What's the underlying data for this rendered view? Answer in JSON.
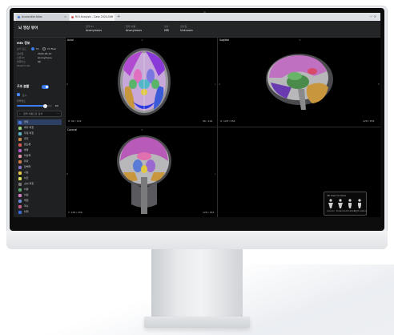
{
  "browser": {
    "tabs": [
      {
        "label": "Accessible Atlas"
      },
      {
        "label": "ROI Analysis - Case 2024-019"
      }
    ],
    "new_tab": "+",
    "window_controls": "—  ×"
  },
  "header": {
    "title": "뇌 영상 뷰어",
    "fields": [
      {
        "label": "환자 ID",
        "value": "Anonymous"
      },
      {
        "label": "환자 이름",
        "value": "Anonymous"
      },
      {
        "label": "검사",
        "value": "MRI"
      },
      {
        "label": "검사일",
        "value": "Unknown"
      }
    ]
  },
  "sidebar": {
    "mri_section": "MRI 정보",
    "view_label": "보기 모드",
    "view_options": [
      "T1",
      "T2 Flair"
    ],
    "rows": [
      {
        "key": "검사일",
        "value": "2024-05-12"
      },
      {
        "key": "스캔 ID",
        "value": "Anonymous"
      },
      {
        "key": "슬라이스",
        "value": "96"
      },
      {
        "key": "Stretch Val.",
        "value": ""
      }
    ],
    "roi_section": "구조 분할",
    "show_label": "표시",
    "opacity_label": "불투명도",
    "opacity_value": "80",
    "opacity_pct": 0.8,
    "search_placeholder": "영역 이름으로 검색",
    "regions": [
      {
        "name": "전두",
        "color": "#4a78d8"
      },
      {
        "name": "측두 피질",
        "color": "#9ad07a"
      },
      {
        "name": "두정 피질",
        "color": "#5fb4c8"
      },
      {
        "name": "후두",
        "color": "#c48a46"
      },
      {
        "name": "편도체",
        "color": "#d45a5a"
      },
      {
        "name": "해마",
        "color": "#b85ac8"
      },
      {
        "name": "미상핵",
        "color": "#e08fa0"
      },
      {
        "name": "피각",
        "color": "#d07a48"
      },
      {
        "name": "창백핵",
        "color": "#8a74c8"
      },
      {
        "name": "시상",
        "color": "#e4c84a"
      },
      {
        "name": "뇌간",
        "color": "#e0e060"
      },
      {
        "name": "소뇌 피질",
        "color": "#7a7a7a"
      },
      {
        "name": "뇌량",
        "color": "#5aa86a"
      },
      {
        "name": "뇌실",
        "color": "#d07ac0"
      },
      {
        "name": "백질",
        "color": "#6a8ad8"
      },
      {
        "name": "척수",
        "color": "#c85a8a"
      },
      {
        "name": "뇌척",
        "color": "#3a6ae0"
      }
    ]
  },
  "viewports": [
    {
      "label": "Axial",
      "info_left": "Z: 96 / 192",
      "info_right": "96 / 192",
      "markers": {
        "left": "R",
        "right": "L",
        "top": "A",
        "bottom": "P"
      }
    },
    {
      "label": "Sagittal",
      "info_left": "X: 128 / 256",
      "info_right": "128 / 256",
      "markers": {
        "left": "A",
        "right": "P",
        "top": "S",
        "bottom": "I"
      }
    },
    {
      "label": "Coronal",
      "info_left": "Y: 128 / 256",
      "info_right": "128 / 256",
      "markers": {
        "left": "R",
        "right": "L",
        "top": "S",
        "bottom": "I"
      }
    },
    {
      "label": "",
      "info_left": "",
      "info_right": "",
      "markers": {
        "left": "",
        "right": "",
        "top": "",
        "bottom": ""
      }
    }
  ],
  "orientation_widget": {
    "title": "3D View Controls",
    "views": [
      "Anterior",
      "Posterior",
      "Left Lateral",
      "Right Lateral"
    ]
  },
  "colors": {
    "accent": "#3d7bf0",
    "screen_bg": "#161718",
    "panel_bg": "#1f2022"
  }
}
